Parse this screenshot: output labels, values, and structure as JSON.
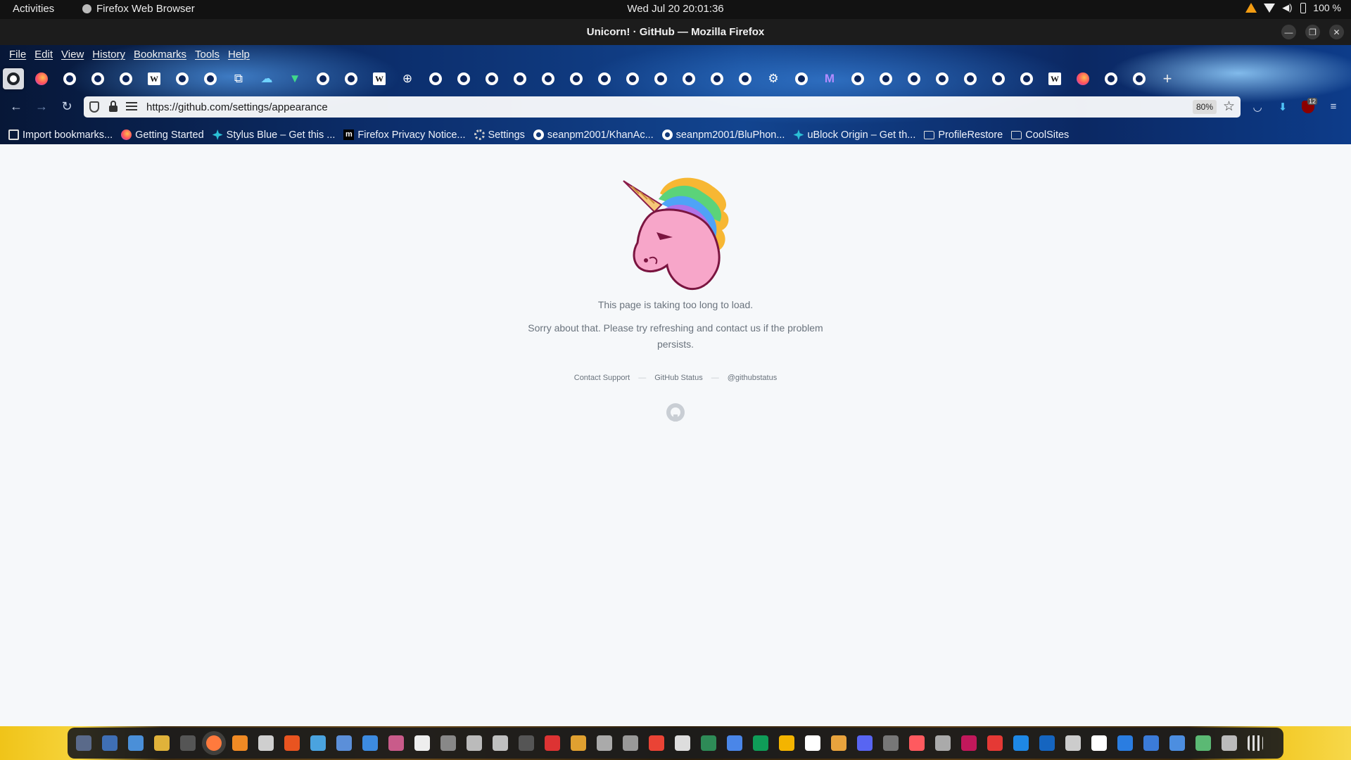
{
  "system_bar": {
    "activities": "Activities",
    "app_name": "Firefox Web Browser",
    "clock": "Wed Jul 20  20:01:36",
    "battery": "100 %"
  },
  "window": {
    "title": "Unicorn! · GitHub — Mozilla Firefox"
  },
  "menu": {
    "file": "File",
    "edit": "Edit",
    "view": "View",
    "history": "History",
    "bookmarks": "Bookmarks",
    "tools": "Tools",
    "help": "Help"
  },
  "tabs": [
    {
      "icon": "github-icon",
      "active": true
    },
    {
      "icon": "firefox-icon"
    },
    {
      "icon": "github-icon"
    },
    {
      "icon": "github-icon"
    },
    {
      "icon": "github-icon"
    },
    {
      "icon": "wikipedia-icon"
    },
    {
      "icon": "github-icon"
    },
    {
      "icon": "github-icon"
    },
    {
      "icon": "puzzle-icon"
    },
    {
      "icon": "cloud-icon"
    },
    {
      "icon": "vuejs-icon"
    },
    {
      "icon": "github-icon"
    },
    {
      "icon": "github-icon"
    },
    {
      "icon": "wikipedia-icon"
    },
    {
      "icon": "globe-icon"
    },
    {
      "icon": "github-icon"
    },
    {
      "icon": "github-icon"
    },
    {
      "icon": "github-icon"
    },
    {
      "icon": "github-icon"
    },
    {
      "icon": "github-icon"
    },
    {
      "icon": "github-icon"
    },
    {
      "icon": "github-icon"
    },
    {
      "icon": "github-icon"
    },
    {
      "icon": "github-icon"
    },
    {
      "icon": "github-icon"
    },
    {
      "icon": "github-icon"
    },
    {
      "icon": "github-icon"
    },
    {
      "icon": "gear-icon"
    },
    {
      "icon": "github-icon"
    },
    {
      "icon": "proton-mail-icon"
    },
    {
      "icon": "github-icon"
    },
    {
      "icon": "github-icon"
    },
    {
      "icon": "github-icon"
    },
    {
      "icon": "github-icon"
    },
    {
      "icon": "github-icon"
    },
    {
      "icon": "github-icon"
    },
    {
      "icon": "github-icon"
    },
    {
      "icon": "wikipedia-icon"
    },
    {
      "icon": "firefox-icon"
    },
    {
      "icon": "github-icon"
    },
    {
      "icon": "github-icon"
    }
  ],
  "new_tab_label": "+",
  "urlbar": {
    "url": "https://github.com/settings/appearance",
    "zoom": "80%",
    "ublock_badge": "12"
  },
  "bookmarks": [
    {
      "icon": "import",
      "label": "Import bookmarks..."
    },
    {
      "icon": "ff",
      "label": "Getting Started"
    },
    {
      "icon": "stylus",
      "label": "Stylus Blue – Get this ..."
    },
    {
      "icon": "moz",
      "label": "Firefox Privacy Notice..."
    },
    {
      "icon": "gear",
      "label": "Settings"
    },
    {
      "icon": "ghb",
      "label": "seanpm2001/KhanAc..."
    },
    {
      "icon": "ghb",
      "label": "seanpm2001/BluPhon..."
    },
    {
      "icon": "stylus",
      "label": "uBlock Origin – Get th..."
    },
    {
      "icon": "folder",
      "label": "ProfileRestore"
    },
    {
      "icon": "folder",
      "label": "CoolSites"
    }
  ],
  "page": {
    "message_primary": "This page is taking too long to load.",
    "message_secondary": "Sorry about that. Please try refreshing and contact us if the problem persists.",
    "link_support": "Contact Support",
    "separator": "—",
    "link_status": "GitHub Status",
    "link_twitter": "@githubstatus"
  },
  "dock_colors": [
    "#5a6a8a",
    "#3f6fb5",
    "#4a8fd8",
    "#e0b23a",
    "#555",
    "#ff7a3d",
    "#f08a24",
    "#cfcfcf",
    "#e95420",
    "#4aa3df",
    "#5b8fd9",
    "#3d8be0",
    "#c95b8a",
    "#eeeeee",
    "#888",
    "#bbbbbb",
    "#c0c0c0",
    "#555",
    "#d33",
    "#e0a030",
    "#aaaaaa",
    "#999",
    "#ea4335",
    "#dddddd",
    "#2e8b57",
    "#4a86e8",
    "#0f9d58",
    "#f4b400",
    "#ffffff",
    "#e8a33d",
    "#5865f2",
    "#777",
    "#ff5a5f",
    "#aaaaaa",
    "#c2185b",
    "#e53935",
    "#1e88e5",
    "#1565c0",
    "#cccccc",
    "#ffffff",
    "#2a7de1",
    "#3b7bd8",
    "#4c8ee0",
    "#5bb974",
    "#bbbbbb"
  ]
}
